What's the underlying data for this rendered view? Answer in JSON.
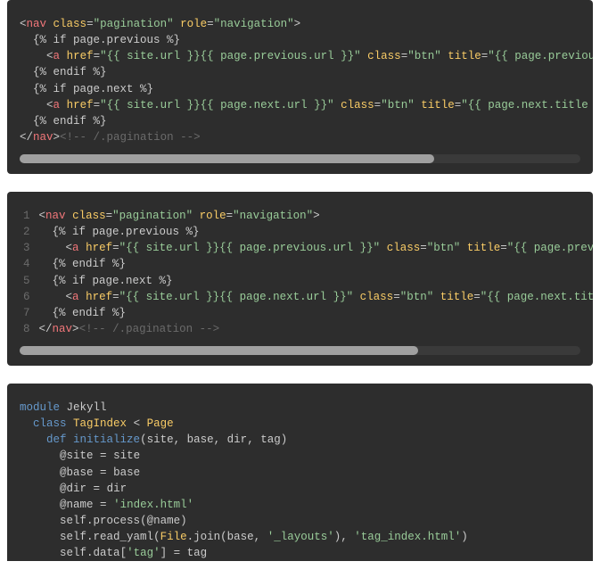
{
  "block1": {
    "lines": [
      {
        "indent": 0,
        "html": "<span class=\"p\">&lt;</span><span class=\"nt\">nav</span> <span class=\"na\">class</span><span class=\"p\">=</span><span class=\"s\">\"pagination\"</span> <span class=\"na\">role</span><span class=\"p\">=</span><span class=\"s\">\"navigation\"</span><span class=\"p\">&gt;</span>"
      },
      {
        "indent": 1,
        "html": "<span class=\"p\">{% if page.previous %}</span>"
      },
      {
        "indent": 2,
        "html": "<span class=\"p\">&lt;</span><span class=\"nt\">a</span> <span class=\"na\">href</span><span class=\"p\">=</span><span class=\"s\">\"{{ site.url }}{{ page.previous.url }}\"</span> <span class=\"na\">class</span><span class=\"p\">=</span><span class=\"s\">\"btn\"</span> <span class=\"na\">title</span><span class=\"p\">=</span><span class=\"s\">\"{{ page.previous.tit</span>"
      },
      {
        "indent": 1,
        "html": "<span class=\"p\">{% endif %}</span>"
      },
      {
        "indent": 1,
        "html": "<span class=\"p\">{% if page.next %}</span>"
      },
      {
        "indent": 2,
        "html": "<span class=\"p\">&lt;</span><span class=\"nt\">a</span> <span class=\"na\">href</span><span class=\"p\">=</span><span class=\"s\">\"{{ site.url }}{{ page.next.url }}\"</span> <span class=\"na\">class</span><span class=\"p\">=</span><span class=\"s\">\"btn\"</span> <span class=\"na\">title</span><span class=\"p\">=</span><span class=\"s\">\"{{ page.next.title }}\"</span><span class=\"p\">&gt;</span><span class=\"p\">N</span>"
      },
      {
        "indent": 1,
        "html": "<span class=\"p\">{% endif %}</span>"
      },
      {
        "indent": 0,
        "html": "<span class=\"p\">&lt;/</span><span class=\"nt\">nav</span><span class=\"p\">&gt;</span><span class=\"c\">&lt;!-- /.pagination --&gt;</span>"
      }
    ],
    "thumbWidthPct": 74
  },
  "block2": {
    "linenos": [
      "1",
      "2",
      "3",
      "4",
      "5",
      "6",
      "7",
      "8"
    ],
    "lines": [
      {
        "indent": 0,
        "html": "<span class=\"p\">&lt;</span><span class=\"nt\">nav</span> <span class=\"na\">class</span><span class=\"p\">=</span><span class=\"s\">\"pagination\"</span> <span class=\"na\">role</span><span class=\"p\">=</span><span class=\"s\">\"navigation\"</span><span class=\"p\">&gt;</span>"
      },
      {
        "indent": 1,
        "html": "<span class=\"p\">{% if page.previous %}</span>"
      },
      {
        "indent": 2,
        "html": "<span class=\"p\">&lt;</span><span class=\"nt\">a</span> <span class=\"na\">href</span><span class=\"p\">=</span><span class=\"s\">\"{{ site.url }}{{ page.previous.url }}\"</span> <span class=\"na\">class</span><span class=\"p\">=</span><span class=\"s\">\"btn\"</span> <span class=\"na\">title</span><span class=\"p\">=</span><span class=\"s\">\"{{ page.previo</span>"
      },
      {
        "indent": 1,
        "html": "<span class=\"p\">{% endif %}</span>"
      },
      {
        "indent": 1,
        "html": "<span class=\"p\">{% if page.next %}</span>"
      },
      {
        "indent": 2,
        "html": "<span class=\"p\">&lt;</span><span class=\"nt\">a</span> <span class=\"na\">href</span><span class=\"p\">=</span><span class=\"s\">\"{{ site.url }}{{ page.next.url }}\"</span> <span class=\"na\">class</span><span class=\"p\">=</span><span class=\"s\">\"btn\"</span> <span class=\"na\">title</span><span class=\"p\">=</span><span class=\"s\">\"{{ page.next.title</span>"
      },
      {
        "indent": 1,
        "html": "<span class=\"p\">{% endif %}</span>"
      },
      {
        "indent": 0,
        "html": "<span class=\"p\">&lt;/</span><span class=\"nt\">nav</span><span class=\"p\">&gt;</span><span class=\"c\">&lt;!-- /.pagination --&gt;</span>"
      }
    ],
    "thumbWidthPct": 71
  },
  "block3": {
    "lines": [
      {
        "indent": 0,
        "html": "<span class=\"kw\">module</span> <span class=\"p\">Jekyll</span>"
      },
      {
        "indent": 1,
        "html": "<span class=\"kw\">class</span> <span class=\"cls\">TagIndex</span> <span class=\"p\">&lt;</span> <span class=\"pagecls\">Page</span>"
      },
      {
        "indent": 2,
        "html": "<span class=\"kw\">def</span> <span class=\"fn\">initialize</span><span class=\"p\">(</span><span class=\"p\">site</span><span class=\"p\">,</span> <span class=\"p\">base</span><span class=\"p\">,</span> <span class=\"p\">dir</span><span class=\"p\">,</span> <span class=\"p\">tag</span><span class=\"p\">)</span>"
      },
      {
        "indent": 3,
        "html": "<span class=\"at\">@site</span> <span class=\"op\">=</span> <span class=\"p\">site</span>"
      },
      {
        "indent": 3,
        "html": "<span class=\"at\">@base</span> <span class=\"op\">=</span> <span class=\"p\">base</span>"
      },
      {
        "indent": 3,
        "html": "<span class=\"at\">@dir</span> <span class=\"op\">=</span> <span class=\"p\">dir</span>"
      },
      {
        "indent": 3,
        "html": "<span class=\"at\">@name</span> <span class=\"op\">=</span> <span class=\"str\">'index.html'</span>"
      },
      {
        "indent": 3,
        "html": "<span class=\"p\">self</span><span class=\"p\">.</span><span class=\"p\">process</span><span class=\"p\">(</span><span class=\"at\">@name</span><span class=\"p\">)</span>"
      },
      {
        "indent": 3,
        "html": "<span class=\"p\">self</span><span class=\"p\">.</span><span class=\"p\">read_yaml</span><span class=\"p\">(</span><span class=\"cls\">File</span><span class=\"p\">.</span><span class=\"p\">join</span><span class=\"p\">(</span><span class=\"p\">base</span><span class=\"p\">,</span> <span class=\"str\">'_layouts'</span><span class=\"p\">),</span> <span class=\"str\">'tag_index.html'</span><span class=\"p\">)</span>"
      },
      {
        "indent": 3,
        "html": "<span class=\"p\">self</span><span class=\"p\">.</span><span class=\"p\">data</span><span class=\"p\">[</span><span class=\"str\">'tag'</span><span class=\"p\">]</span> <span class=\"op\">=</span> <span class=\"p\">tag</span>"
      }
    ]
  }
}
